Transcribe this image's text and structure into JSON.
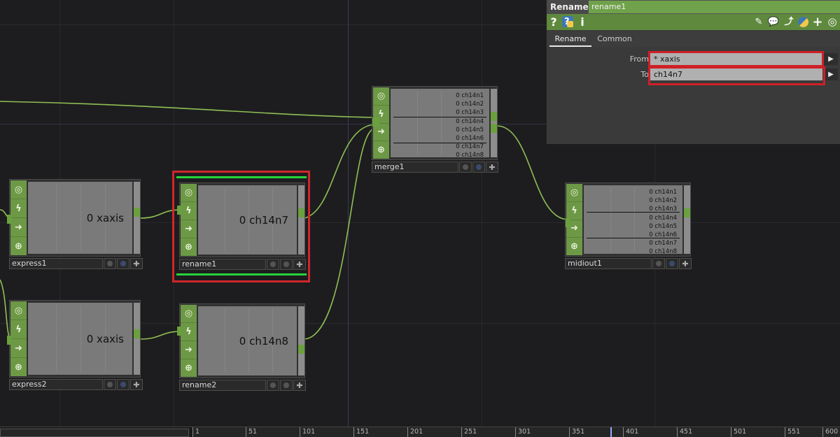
{
  "network": {
    "nodes": {
      "express1": {
        "name": "express1",
        "value": "0 xaxis"
      },
      "express2": {
        "name": "express2",
        "value": "0 xaxis"
      },
      "rename1": {
        "name": "rename1",
        "value": "0 ch14n7"
      },
      "rename2": {
        "name": "rename2",
        "value": "0 ch14n8"
      },
      "merge1": {
        "name": "merge1",
        "channels": [
          "0 ch14n1",
          "0 ch14n2",
          "0 ch14n3",
          "0 ch14n4",
          "0 ch14n5",
          "0 ch14n6",
          "0 ch14n7",
          "0 ch14n8"
        ]
      },
      "midiout1": {
        "name": "midiout1",
        "channels": [
          "0 ch14n1",
          "0 ch14n2",
          "0 ch14n3",
          "0 ch14n4",
          "0 ch14n5",
          "0 ch14n6",
          "0 ch14n7",
          "0 ch14n8"
        ]
      }
    },
    "icons": [
      "viewer-icon",
      "bypass-icon",
      "display-arrow-icon",
      "lock-icon"
    ],
    "colors": {
      "op_green": "#6d9946",
      "wire": "#8fbf54",
      "selection_red": "#d0262b",
      "selected_green": "#26d43a"
    }
  },
  "panel": {
    "op_type": "Rename",
    "op_name": "rename1",
    "toolbar": {
      "help": "?",
      "python_help": "?",
      "info": "i"
    },
    "tabs": [
      {
        "label": "Rename"
      },
      {
        "label": "Common"
      }
    ],
    "params": {
      "from": {
        "label": "From",
        "value": "* xaxis"
      },
      "to": {
        "label": "To",
        "value": "ch14n7"
      }
    }
  },
  "timeline": {
    "ticks": [
      "1",
      "51",
      "101",
      "151",
      "201",
      "251",
      "301",
      "351",
      "401",
      "451",
      "501",
      "551",
      "600"
    ]
  }
}
